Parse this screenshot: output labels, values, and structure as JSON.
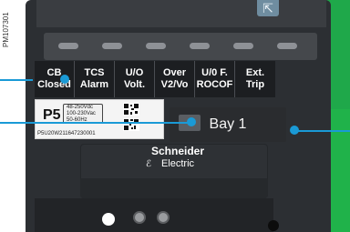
{
  "doc_ref": "PM107301",
  "colors": {
    "callout": "#1a9ad6",
    "device": "#2c2f33",
    "board": "#20b24a"
  },
  "labels": [
    {
      "line1": "CB",
      "line2": "Closed"
    },
    {
      "line1": "TCS",
      "line2": "Alarm"
    },
    {
      "line1": "U/O",
      "line2": "Volt."
    },
    {
      "line1": "Over",
      "line2": "V2/Vo"
    },
    {
      "line1": "U/0 F.",
      "line2": "ROCOF"
    },
    {
      "line1": "Ext.",
      "line2": "Trip"
    }
  ],
  "nameplate": {
    "model": "P5",
    "specs": [
      "48-250Vdc",
      "100-230Vac",
      "50-60Hz"
    ],
    "serial": "P5U20W211647230001"
  },
  "bay_label": "Bay 1",
  "brand": {
    "name": "Schneider",
    "sub": "Electric"
  },
  "icons": {
    "top_corner": "N-arrow-icon",
    "logo": "schneider-logo-icon"
  }
}
